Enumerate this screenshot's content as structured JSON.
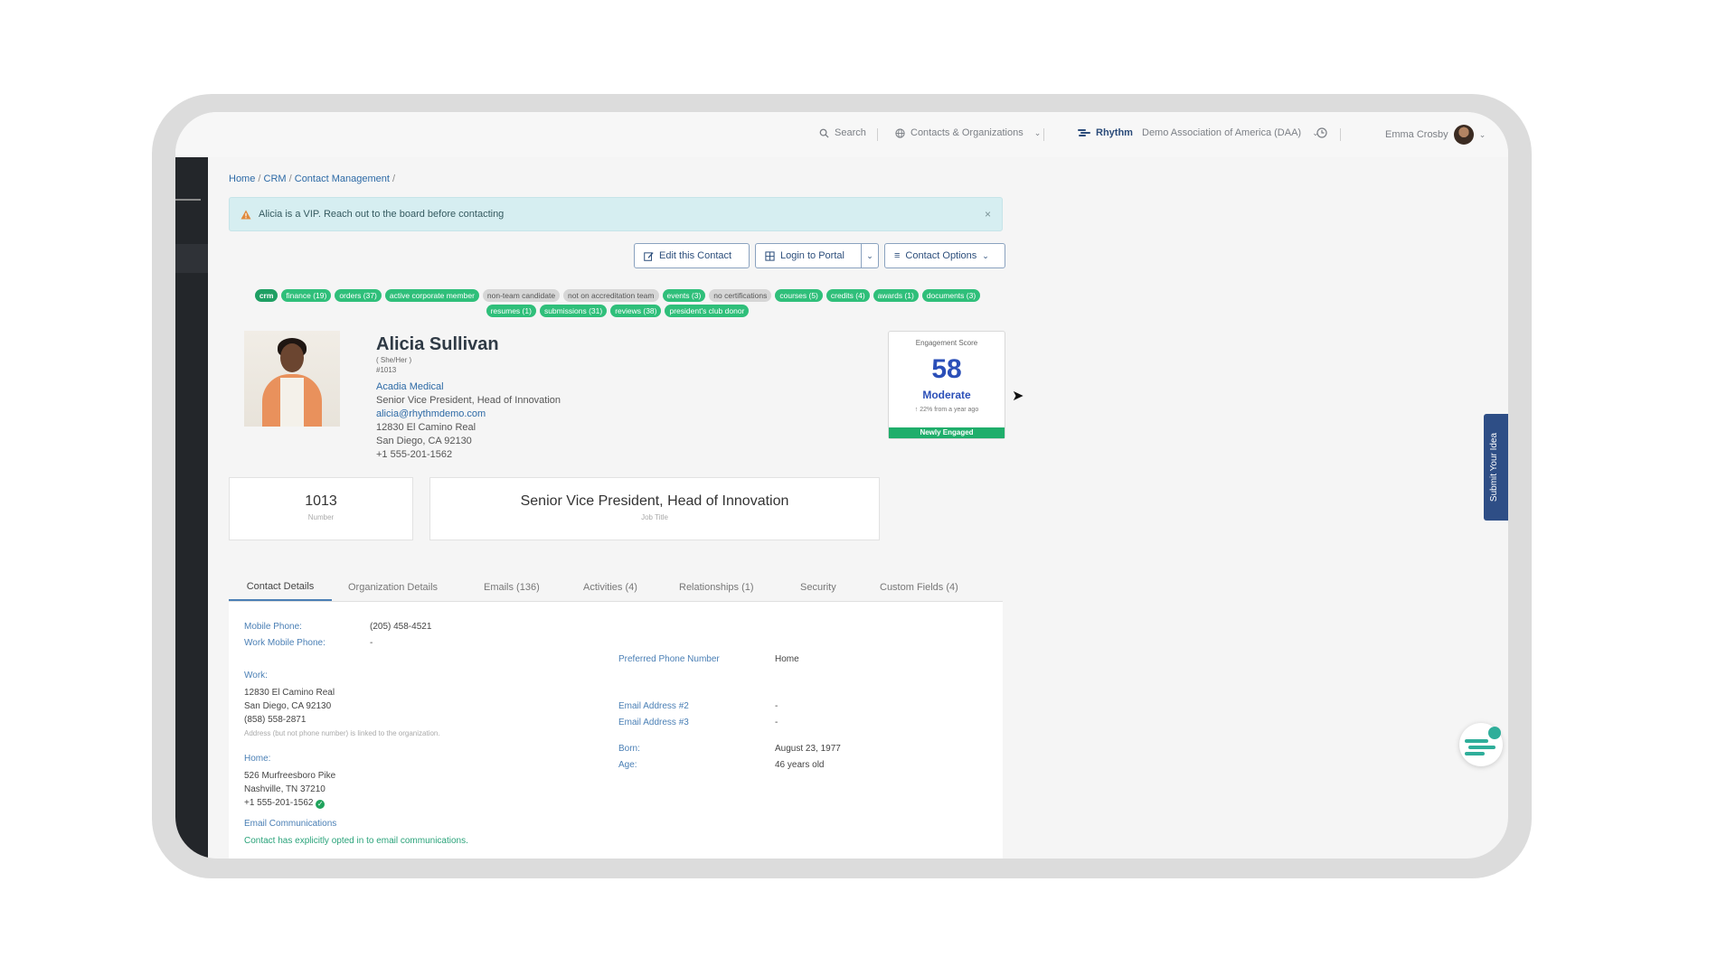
{
  "topbar": {
    "search": "Search",
    "contacts_menu": "Contacts & Organizations",
    "brand": "Rhythm",
    "org": "Demo Association of America (DAA)",
    "user": "Emma Crosby"
  },
  "breadcrumb": {
    "home": "Home",
    "crm": "CRM",
    "contact_management": "Contact Management"
  },
  "alert": {
    "text": "Alicia is a VIP. Reach out to the board before contacting",
    "close": "×"
  },
  "actions": {
    "edit": "Edit this Contact",
    "login": "Login to Portal",
    "options": "Contact Options"
  },
  "tags": [
    {
      "label": "crm",
      "style": "dark"
    },
    {
      "label": "finance (19)",
      "style": "green"
    },
    {
      "label": "orders (37)",
      "style": "green"
    },
    {
      "label": "active corporate member",
      "style": "green"
    },
    {
      "label": "non-team candidate",
      "style": "gray"
    },
    {
      "label": "not on accreditation team",
      "style": "gray"
    },
    {
      "label": "events (3)",
      "style": "green"
    },
    {
      "label": "no certifications",
      "style": "gray"
    },
    {
      "label": "courses (5)",
      "style": "green"
    },
    {
      "label": "credits (4)",
      "style": "green"
    },
    {
      "label": "awards (1)",
      "style": "green"
    },
    {
      "label": "documents (3)",
      "style": "green"
    },
    {
      "label": "resumes (1)",
      "style": "green"
    },
    {
      "label": "submissions (31)",
      "style": "green"
    },
    {
      "label": "reviews (38)",
      "style": "green"
    },
    {
      "label": "president's club donor",
      "style": "green"
    }
  ],
  "profile": {
    "name": "Alicia Sullivan",
    "pronouns": "( She/Her )",
    "id": "#1013",
    "organization": "Acadia Medical",
    "title": "Senior Vice President, Head of Innovation",
    "email": "alicia@rhythmdemo.com",
    "address1": "12830 El Camino Real",
    "address2": "San Diego, CA 92130",
    "phone": "+1 555-201-1562"
  },
  "engagement": {
    "label": "Engagement Score",
    "score": "58",
    "level": "Moderate",
    "change": "22% from a year ago",
    "status": "Newly Engaged"
  },
  "cards": {
    "number": {
      "value": "1013",
      "caption": "Number"
    },
    "job_title": {
      "value": "Senior Vice President, Head of Innovation",
      "caption": "Job Title"
    }
  },
  "tabs": [
    "Contact Details",
    "Organization Details",
    "Emails (136)",
    "Activities (4)",
    "Relationships (1)",
    "Security",
    "Custom Fields (4)"
  ],
  "details": {
    "mobile_phone_label": "Mobile Phone:",
    "mobile_phone": "(205) 458-4521",
    "work_mobile_label": "Work Mobile Phone:",
    "work_mobile": "-",
    "work_label": "Work:",
    "work_line1": "12830 El Camino Real",
    "work_line2": "San Diego, CA 92130",
    "work_phone": "(858) 558-2871",
    "work_note": "Address (but not phone number) is linked to the organization.",
    "home_label": "Home:",
    "home_line1": "526 Murfreesboro Pike",
    "home_line2": "Nashville, TN 37210",
    "home_phone": "+1 555-201-1562",
    "email_comms_label": "Email Communications",
    "email_comms": "Contact has explicitly opted in to email communications.",
    "preferred_phone_label": "Preferred Phone Number",
    "preferred_phone": "Home",
    "email2_label": "Email Address #2",
    "email2": "-",
    "email3_label": "Email Address #3",
    "email3": "-",
    "born_label": "Born:",
    "born": "August 23, 1977",
    "age_label": "Age:",
    "age": "46 years old"
  },
  "side": {
    "submit_idea": "Submit Your Idea"
  }
}
